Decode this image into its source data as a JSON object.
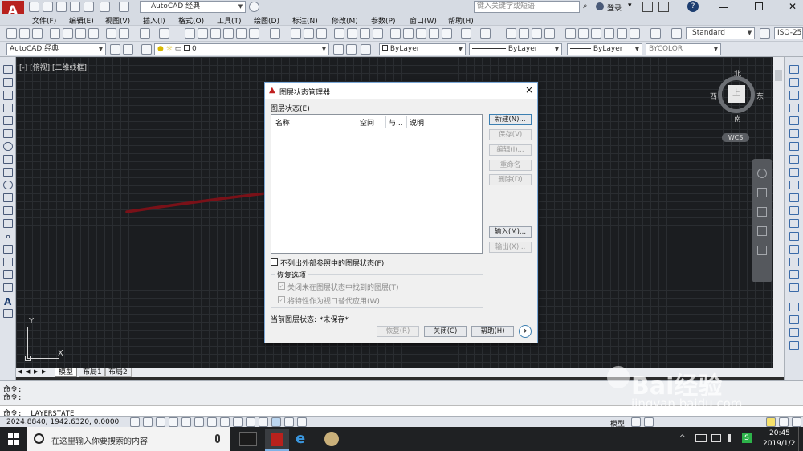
{
  "app": {
    "workspace": "AutoCAD 经典",
    "search_placeholder": "键入关键字或短语",
    "login": "登录",
    "help_icon": "?"
  },
  "menu": [
    "文件(F)",
    "编辑(E)",
    "视图(V)",
    "插入(I)",
    "格式(O)",
    "工具(T)",
    "绘图(D)",
    "标注(N)",
    "修改(M)",
    "参数(P)",
    "窗口(W)",
    "帮助(H)"
  ],
  "toolbar2": {
    "workspace_combo": "AutoCAD 经典",
    "layer_combo": "0",
    "color_combo": "ByLayer",
    "linetype_combo": "ByLayer",
    "lineweight_combo": "ByLayer",
    "plotstyle_combo": "BYCOLOR",
    "textstyle_combo": "Standard",
    "dimstyle_combo": "ISO-25"
  },
  "viewport_label": "[-] [俯视] [二维线框]",
  "viewcube": {
    "north": "北",
    "south": "南",
    "east": "东",
    "west": "西",
    "top": "上",
    "wcs": "WCS"
  },
  "ucs": {
    "x": "X",
    "y": "Y"
  },
  "layout_tabs": [
    "模型",
    "布局1",
    "布局2"
  ],
  "command": {
    "lines": [
      "命令:",
      "命令:"
    ],
    "current": "命令:  _LAYERSTATE"
  },
  "status": {
    "coords": "2024.8840,  1942.6320,  0.0000",
    "model": "模型"
  },
  "dialog": {
    "title": "图层状态管理器",
    "close": "×",
    "section_label": "图层状态(E)",
    "columns": [
      "名称",
      "空间",
      "与...",
      "说明"
    ],
    "buttons": {
      "new": "新建(N)...",
      "save": "保存(V)",
      "edit": "编辑(I)...",
      "rename": "重命名",
      "delete": "删除(D)",
      "import": "输入(M)...",
      "export": "输出(X)..."
    },
    "checkbox_xref": "不列出外部参照中的图层状态(F)",
    "restore_group": "恢复选项",
    "restore_opt1": "关闭未在图层状态中找到的图层(T)",
    "restore_opt2": "将特性作为视口替代应用(W)",
    "current_label": "当前图层状态:",
    "current_value": "*未保存*",
    "restore_btn": "恢复(R)",
    "close_btn": "关闭(C)",
    "help_btn": "帮助(H)",
    "more_btn": "›"
  },
  "taskbar": {
    "search_placeholder": "在这里输入你要搜索的内容",
    "time": "20:45",
    "date": "2019/1/2"
  },
  "watermark": {
    "text": "Bai经验",
    "url": "jingyan.baidu.com"
  },
  "colors": {
    "arrow": "#7a1118",
    "accent": "#3c7fb1",
    "autocad_red": "#b8211d"
  }
}
